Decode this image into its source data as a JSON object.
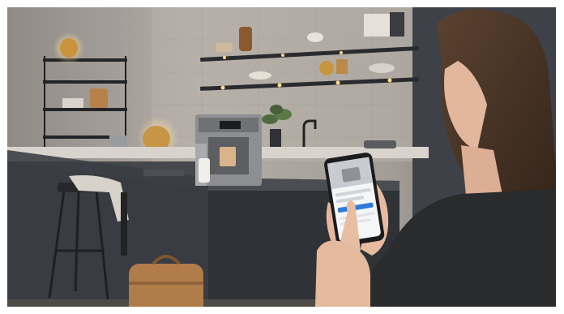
{
  "scene": {
    "subject": "woman-using-smartphone-app",
    "setting": "modern-kitchen",
    "main_object": "fully-automatic-coffee-machine"
  },
  "colors": {
    "wall": "#a59f98",
    "wall_shadow": "#7a7570",
    "counter_top": "#3c3f44",
    "island_front": "#3a3d42",
    "machine_silver": "#8d8f93",
    "warm_light": "#f2c36b",
    "hair": "#4a3426",
    "sweater": "#2b2c2e",
    "skin": "#e9bfa6",
    "phone_screen": "#f4f6f8",
    "app_accent": "#2f7bd8"
  },
  "phone": {
    "screen_line_1": "",
    "screen_line_2": ""
  }
}
